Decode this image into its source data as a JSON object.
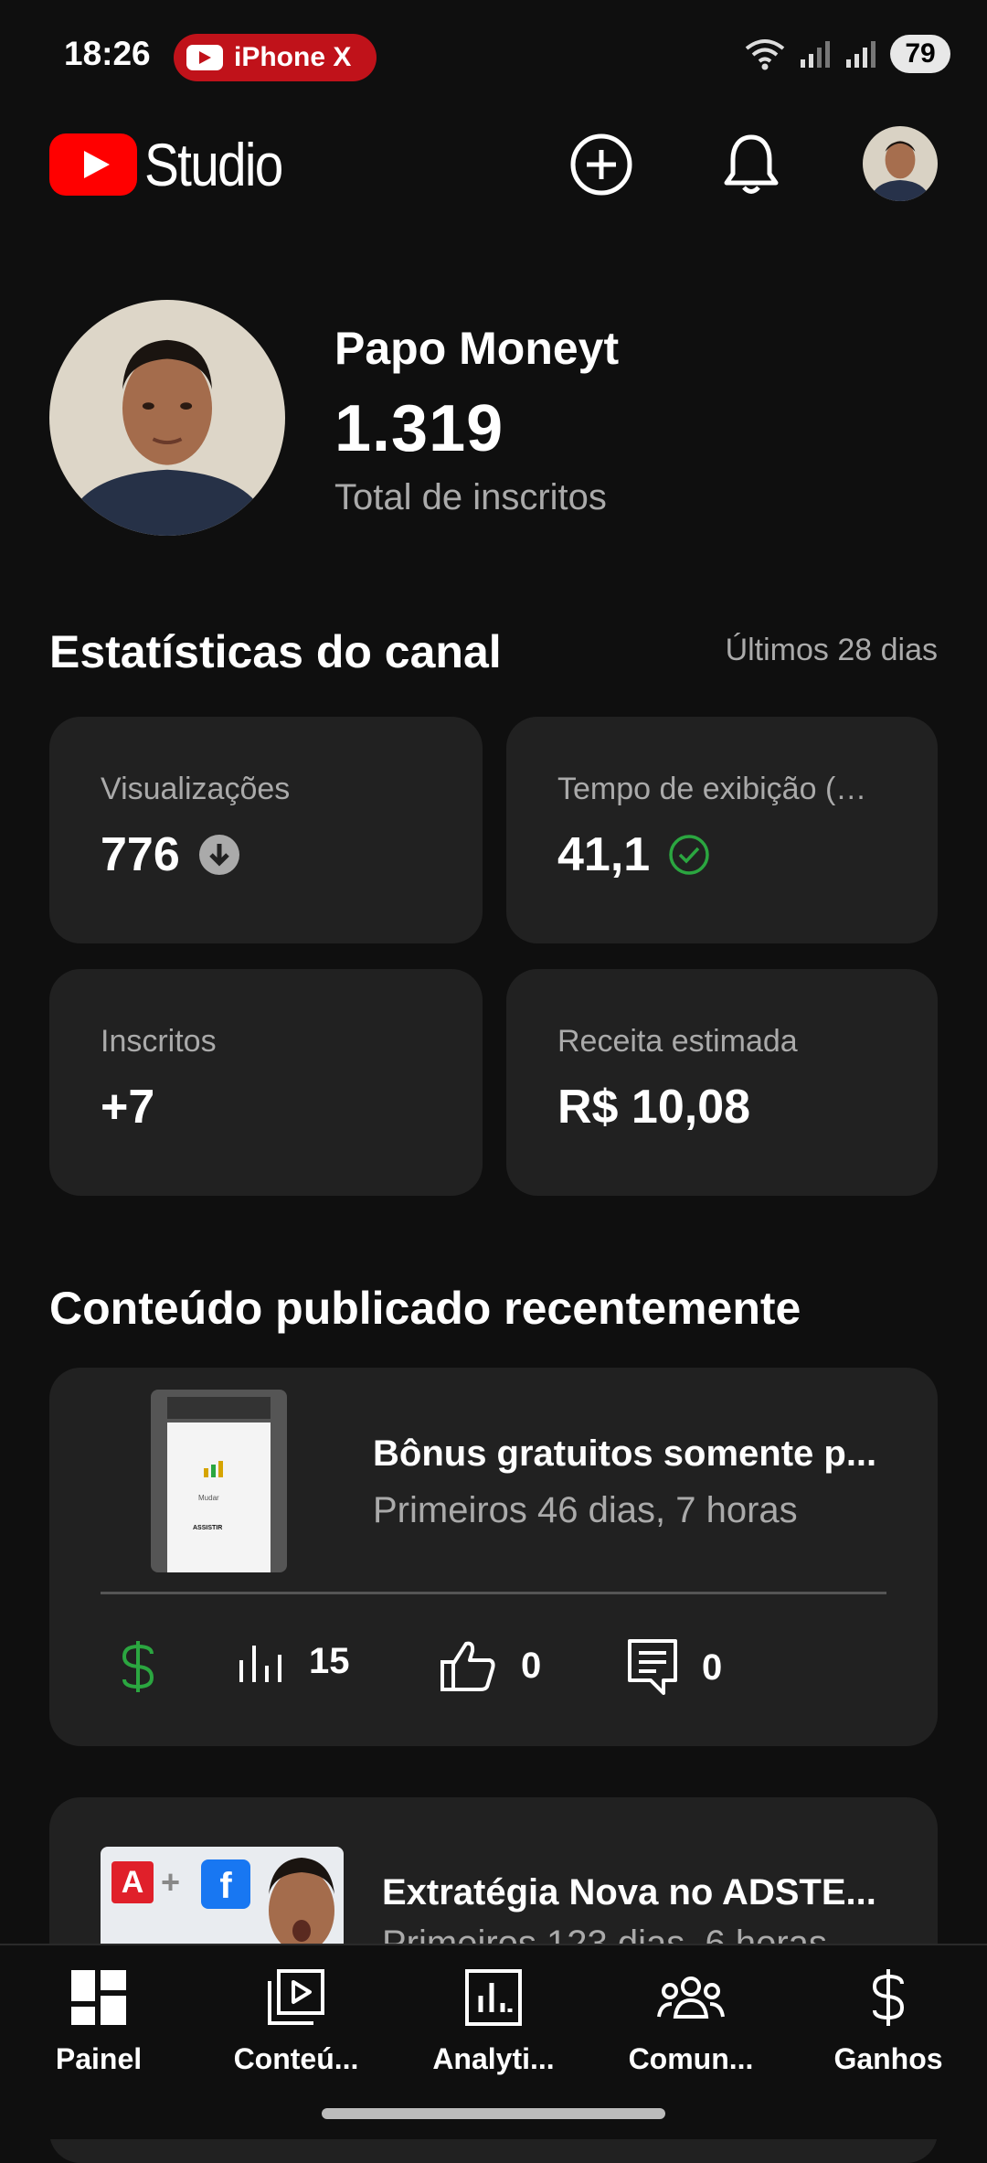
{
  "status_bar": {
    "time": "18:26",
    "pill_label": "iPhone X",
    "battery": "79"
  },
  "header": {
    "app_name": "Studio"
  },
  "channel": {
    "name": "Papo Moneyt",
    "subscriber_count": "1.319",
    "subscriber_label": "Total de inscritos"
  },
  "stats": {
    "title": "Estatísticas do canal",
    "period": "Últimos 28 dias",
    "cards": [
      {
        "label": "Visualizações",
        "value": "776",
        "indicator": "down-arrow-icon"
      },
      {
        "label": "Tempo de exibição (…",
        "value": "41,1",
        "indicator": "check-circle-icon"
      },
      {
        "label": "Inscritos",
        "value": "+7"
      },
      {
        "label": "Receita estimada",
        "value": "R$ 10,08"
      }
    ]
  },
  "recent": {
    "title": "Conteúdo publicado recentemente",
    "videos": [
      {
        "title": "Bônus gratuitos somente p...",
        "subtitle": "Primeiros 46 dias, 7 horas",
        "views": "15",
        "likes": "0",
        "comments": "0",
        "thumb_text": "Mudar",
        "thumb_text2": "ASSISTIR"
      },
      {
        "title": "Extratégia Nova no ADSTE...",
        "subtitle": "Primeiros 123 dias, 6 horas",
        "thumb_badge": "A",
        "thumb_plus": "+",
        "thumb_fb": "f"
      }
    ]
  },
  "nav": [
    {
      "label": "Painel",
      "icon": "dashboard-icon"
    },
    {
      "label": "Conteú...",
      "icon": "content-icon"
    },
    {
      "label": "Analyti...",
      "icon": "analytics-icon"
    },
    {
      "label": "Comun...",
      "icon": "community-icon"
    },
    {
      "label": "Ganhos",
      "icon": "dollar-icon"
    }
  ],
  "colors": {
    "background": "#0f0f0f",
    "card": "#212121",
    "accent_red": "#ff0000",
    "green": "#2ba640"
  }
}
